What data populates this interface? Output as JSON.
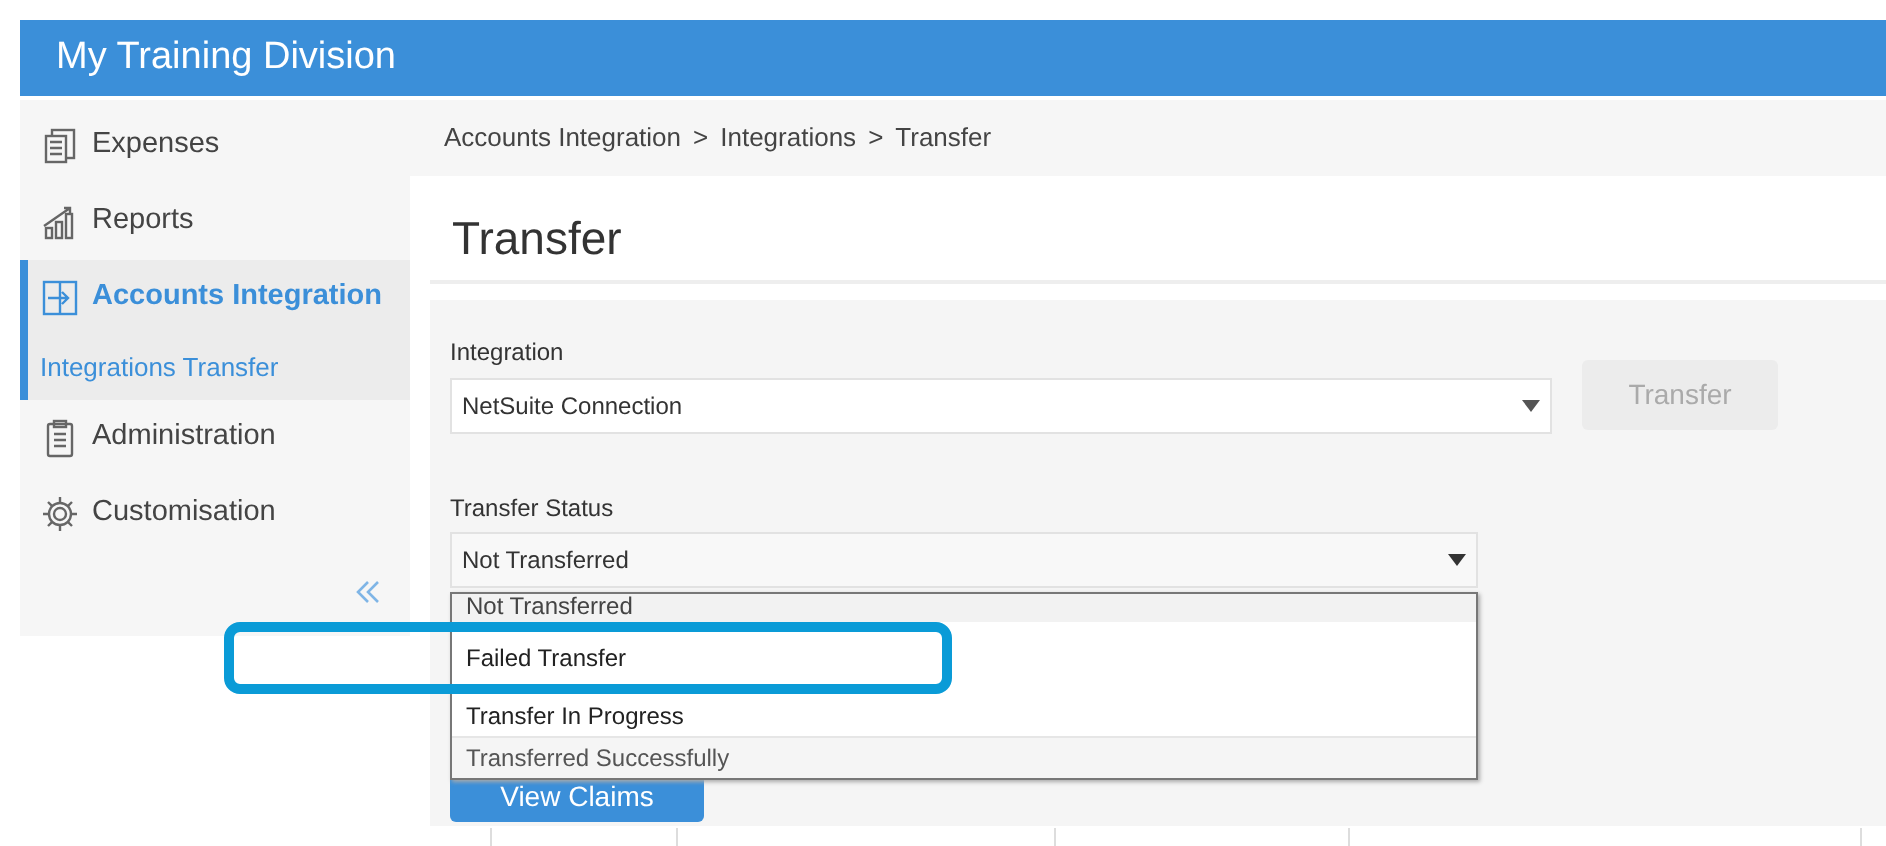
{
  "header": {
    "title": "My Training Division"
  },
  "sidebar": {
    "items": [
      {
        "label": "Expenses",
        "selected": false
      },
      {
        "label": "Reports",
        "selected": false
      },
      {
        "label": "Accounts Integration",
        "selected": true,
        "children": [
          {
            "label": "Integrations Transfer"
          }
        ]
      },
      {
        "label": "Administration",
        "selected": false
      },
      {
        "label": "Customisation",
        "selected": false
      }
    ]
  },
  "breadcrumb": [
    "Accounts Integration",
    ">",
    "Integrations",
    ">",
    "Transfer"
  ],
  "page_title": "Transfer",
  "form": {
    "integration": {
      "label": "Integration",
      "value": "NetSuite Connection"
    },
    "transfer_button": {
      "label": "Transfer",
      "disabled": true
    },
    "transfer_status": {
      "label": "Transfer Status",
      "value": "Not Transferred",
      "expanded": true,
      "options": [
        {
          "label": "Not Transferred",
          "selected": true,
          "hovered": false
        },
        {
          "label": "Failed Transfer",
          "selected": false,
          "hovered": false
        },
        {
          "label": "Transfer In Progress",
          "selected": false,
          "hovered": false
        },
        {
          "label": "Transferred Successfully",
          "selected": false,
          "hovered": true
        }
      ]
    },
    "view_claims_button": {
      "label": "View Claims"
    }
  },
  "annotation": {
    "kind": "highlight-box"
  }
}
